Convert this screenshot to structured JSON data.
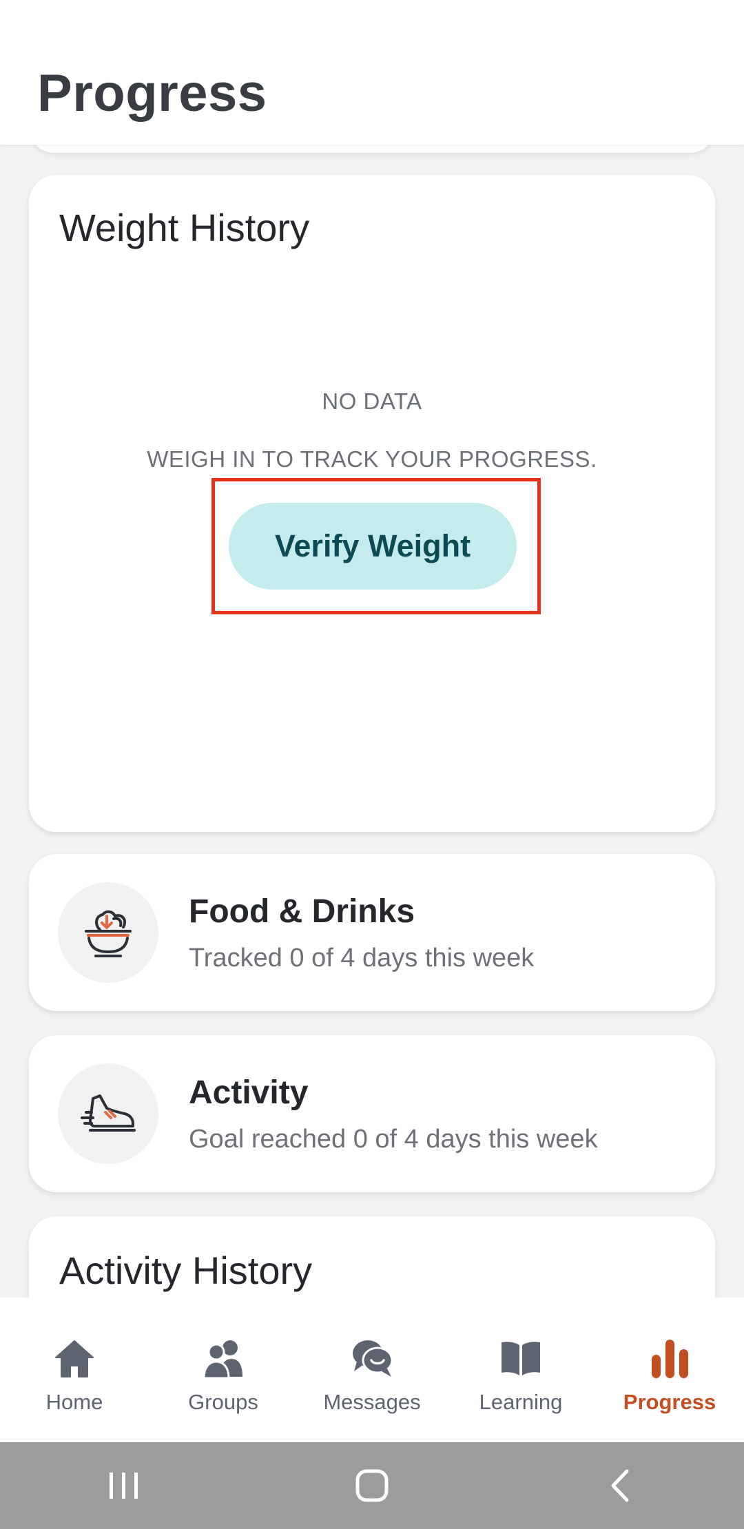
{
  "header": {
    "title": "Progress"
  },
  "weight_card": {
    "title": "Weight History",
    "no_data": "NO DATA",
    "message": "WEIGH IN TO TRACK YOUR PROGRESS.",
    "button_label": "Verify Weight"
  },
  "food_card": {
    "icon": "salad-bowl-icon",
    "title": "Food & Drinks",
    "subtitle": "Tracked 0 of 4 days this week"
  },
  "activity_card": {
    "icon": "sneaker-icon",
    "title": "Activity",
    "subtitle": "Goal reached 0 of 4 days this week"
  },
  "activity_history": {
    "title": "Activity History"
  },
  "nav": {
    "items": [
      {
        "label": "Home",
        "icon": "home-icon"
      },
      {
        "label": "Groups",
        "icon": "groups-icon"
      },
      {
        "label": "Messages",
        "icon": "messages-icon"
      },
      {
        "label": "Learning",
        "icon": "book-icon"
      },
      {
        "label": "Progress",
        "icon": "bar-chart-icon"
      }
    ],
    "active": "Progress"
  },
  "colors": {
    "accent": "#c24e21",
    "button_bg": "#c5eced",
    "button_text": "#0d4a52",
    "highlight": "#e8331a",
    "nav_icon": "#5d6470"
  }
}
